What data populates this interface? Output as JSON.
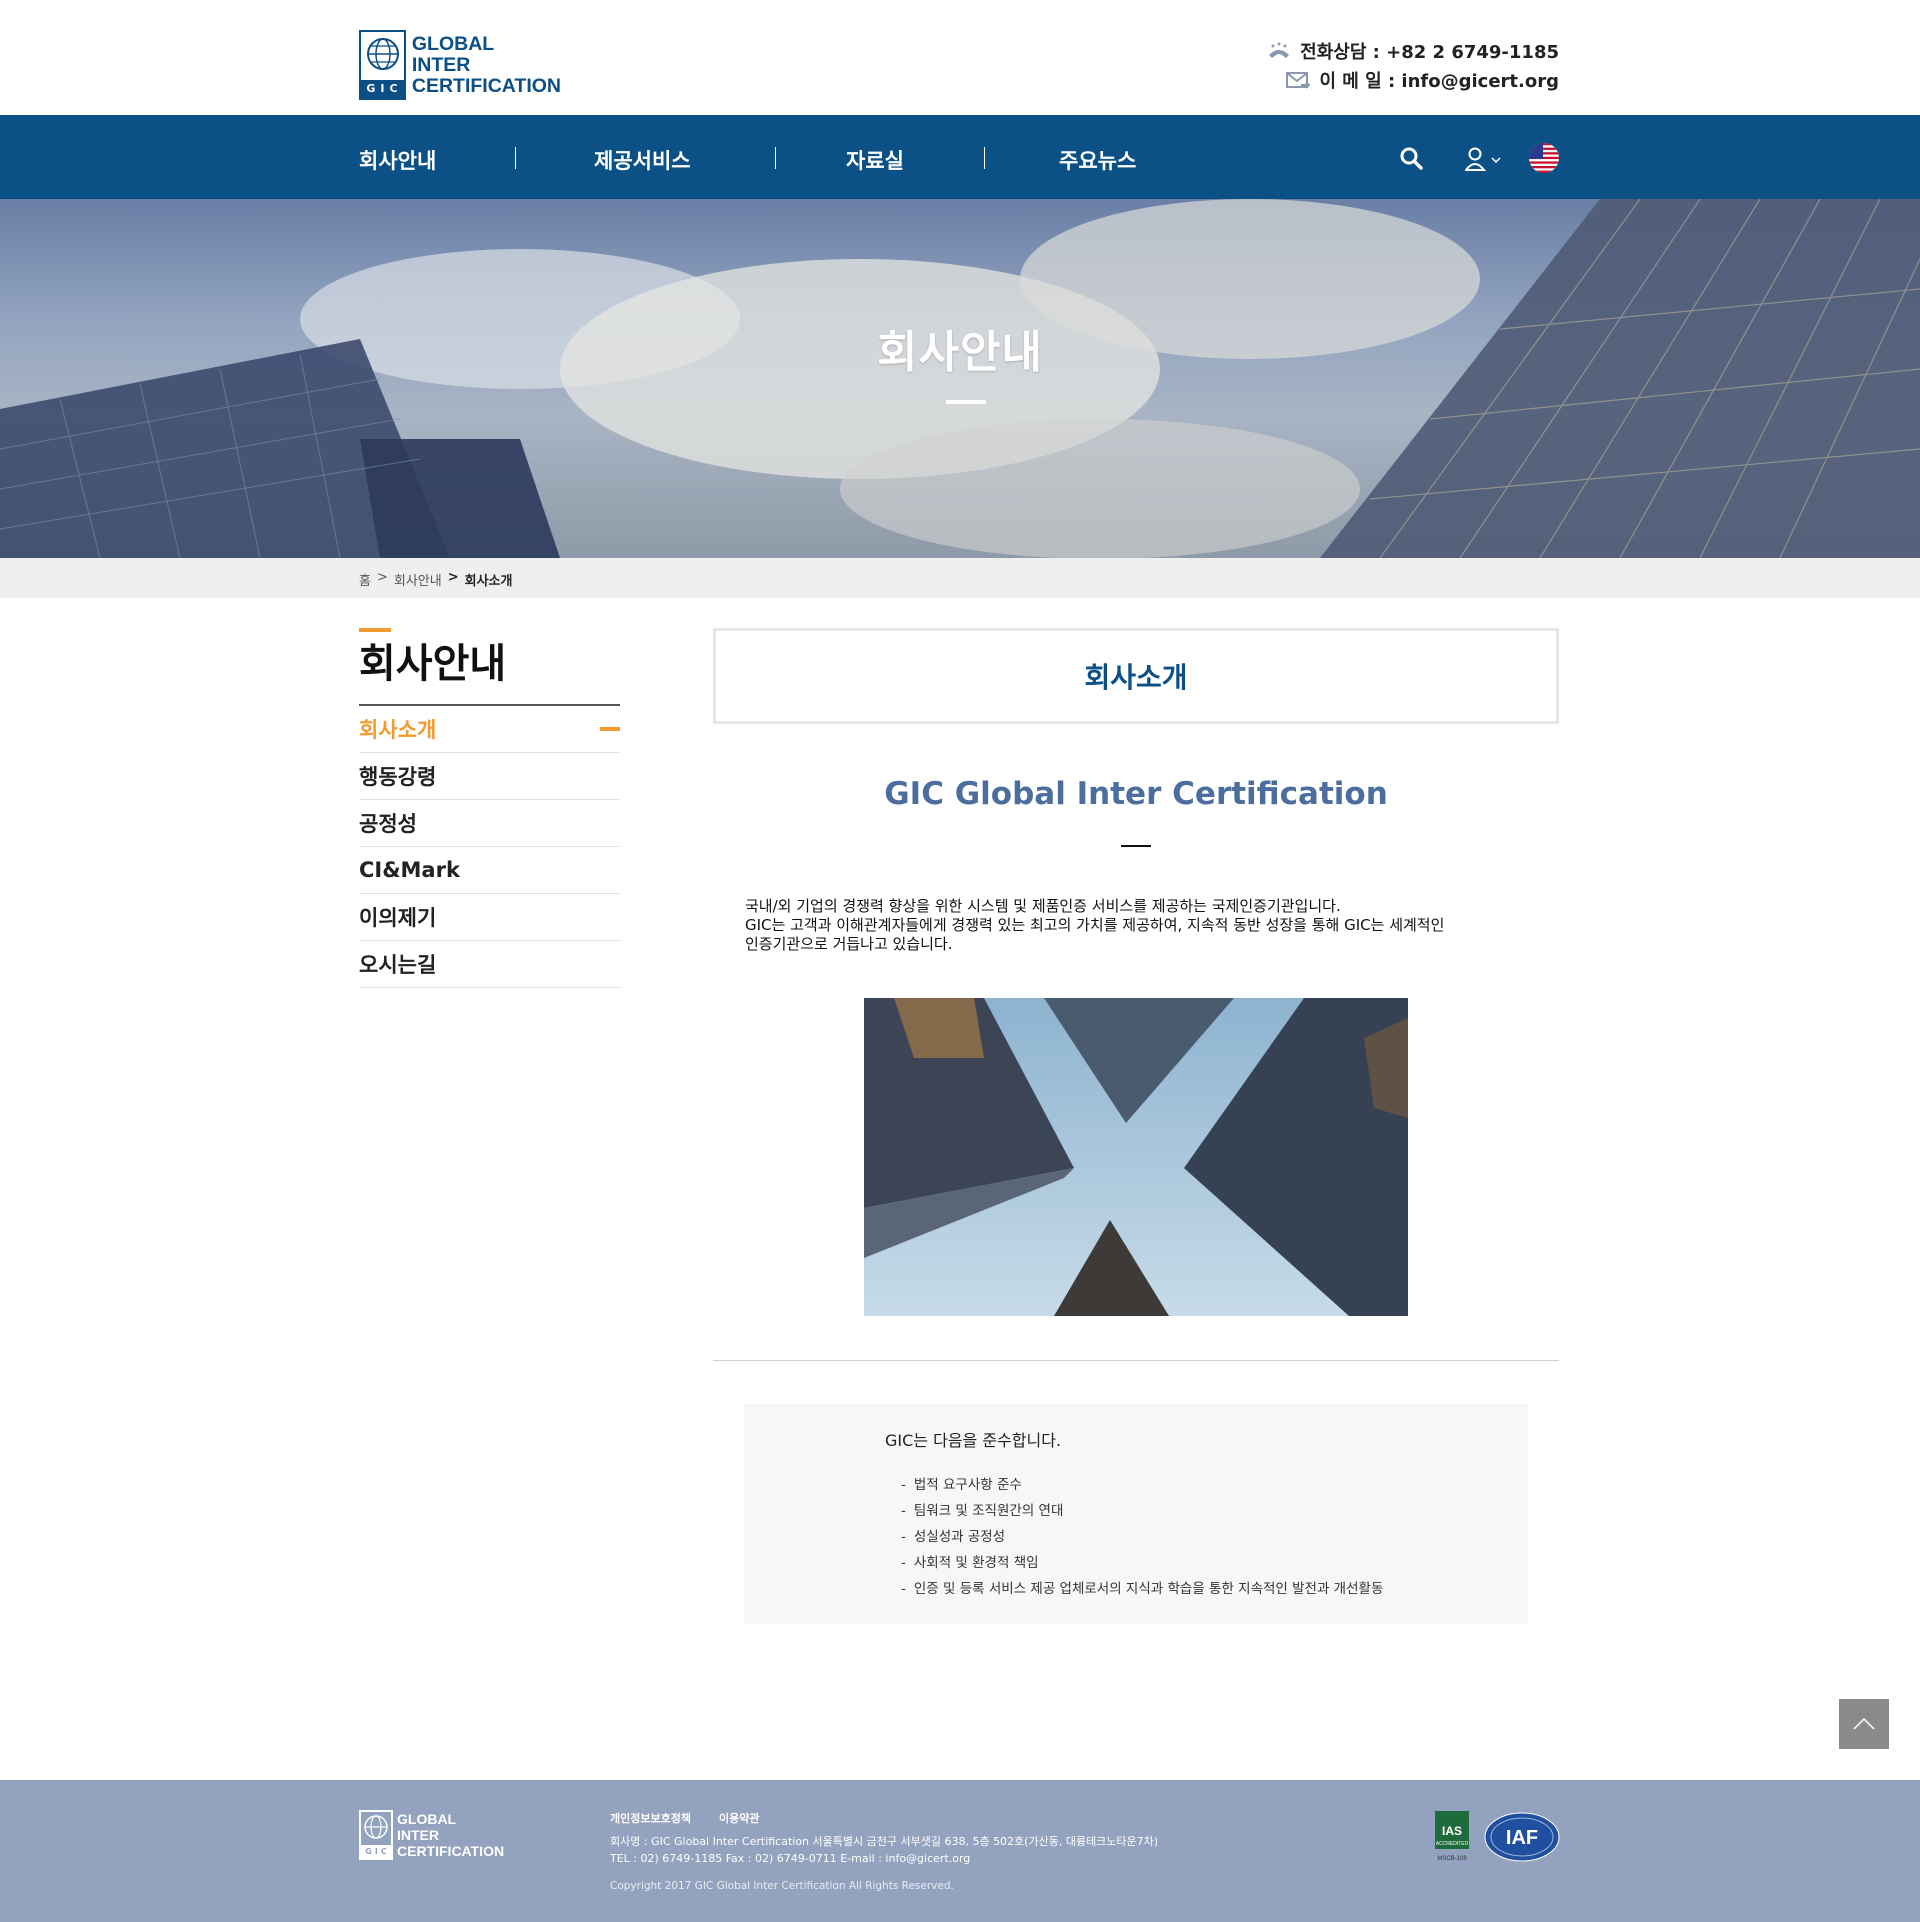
{
  "header": {
    "logo_lines": [
      "GLOBAL",
      "INTER",
      "CERTIFICATION"
    ],
    "logo_badge": "GIC",
    "phone_label": "전화상담 : +82 2 6749-1185",
    "email_label": "이 메 일 : info@gicert.org"
  },
  "nav": {
    "items": [
      "회사안내",
      "제공서비스",
      "자료실",
      "주요뉴스"
    ],
    "icons": [
      "search-icon",
      "user-icon",
      "us-flag-icon"
    ]
  },
  "hero": {
    "title": "회사안내"
  },
  "breadcrumb": {
    "home": "홈",
    "sep": ">",
    "parent": "회사안내",
    "current": "회사소개"
  },
  "sidebar": {
    "title": "회사안내",
    "items": [
      {
        "label": "회사소개",
        "active": true
      },
      {
        "label": "행동강령",
        "active": false
      },
      {
        "label": "공정성",
        "active": false
      },
      {
        "label": "CI&Mark",
        "active": false
      },
      {
        "label": "이의제기",
        "active": false
      },
      {
        "label": "오시는길",
        "active": false
      }
    ]
  },
  "content": {
    "page_title": "회사소개",
    "heading": "GIC Global Inter Certification",
    "intro": [
      "국내/외 기업의 경쟁력 향상을 위한 시스템 및 제품인증 서비스를 제공하는 국제인증기관입니다.",
      "GIC는 고객과 이해관계자들에게 경쟁력 있는 최고의 가치를 제공하여, 지속적 동반 성장을 통해 GIC는 세계적인",
      "인증기관으로 거듭나고 있습니다."
    ],
    "comply_title": "GIC는 다음을 준수합니다.",
    "comply_items": [
      "법적 요구사항 준수",
      "팀워크 및 조직원간의 연대",
      "성실성과 공정성",
      "사회적 및 환경적 책임",
      "인증 및 등록 서비스 제공 업체로서의 지식과 학습을 통한 지속적인 발전과 개선활동"
    ]
  },
  "footer": {
    "logo_lines": [
      "GLOBAL",
      "INTER",
      "CERTIFICATION"
    ],
    "logo_badge": "GIC",
    "links": [
      "개인정보보호정책",
      "이용약관"
    ],
    "company": "회사명 : GIC Global Inter Certification   서울특별시 금천구 서부샛길 638, 5층 502호(가산동, 대륭테크노타운7차)",
    "contact": "TEL : 02) 6749-1185 Fax : 02) 6749-0711 E-mail : info@gicert.org",
    "copyright": "Copyright 2017 GIC Global Inter Certification All Rights Reserved.",
    "cert_badges": [
      {
        "name": "IAS",
        "sub": "ACCREDITED",
        "code": "MSCB-108"
      },
      {
        "name": "IAF"
      }
    ]
  },
  "colors": {
    "nav_bg": "#0c5186",
    "accent_orange": "#f39a2e",
    "heading_blue": "#4c6e9e",
    "footer_bg": "#93a3bf"
  }
}
